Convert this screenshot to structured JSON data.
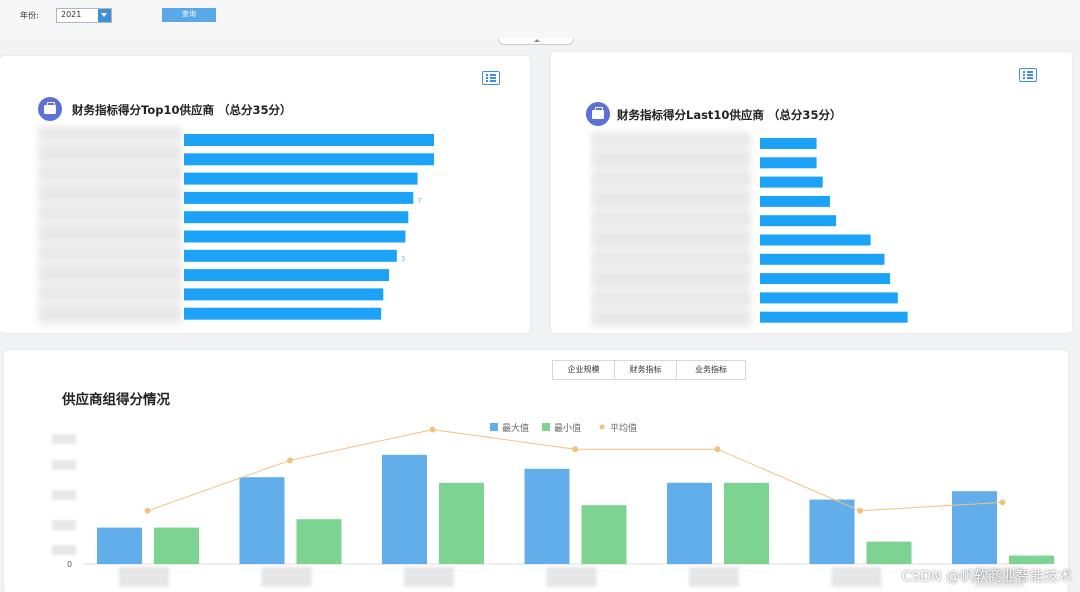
{
  "filter": {
    "year_label": "年份:",
    "year_value": "2021",
    "query_label": "查询"
  },
  "top10": {
    "title": "财务指标得分Top10供应商 （总分35分）",
    "scores": [
      35,
      35,
      32.7,
      32.1,
      31.4,
      31,
      29.8,
      28.7,
      27.9,
      27.6
    ],
    "visible_labels": [
      "7",
      "3"
    ]
  },
  "last10": {
    "title": "财务指标得分Last10供应商 （总分35分）",
    "scores": [
      11,
      11,
      12.2,
      13.6,
      14.8,
      21.5,
      24.2,
      25.3,
      26.8,
      28.7
    ]
  },
  "group_chart": {
    "title": "供应商组得分情况",
    "tabs": [
      "企业规模",
      "财务指标",
      "业务指标"
    ],
    "active_tab": 0,
    "chart_data": {
      "type": "bar",
      "categories": [
        "",
        "",
        "",
        "",
        "",
        "",
        ""
      ],
      "series": [
        {
          "name": "最大值",
          "kind": "bar",
          "color": "#62aeea",
          "values": [
            6.5,
            15.5,
            19.5,
            17.0,
            14.5,
            11.5,
            13.0
          ]
        },
        {
          "name": "最小值",
          "kind": "bar",
          "color": "#7dd391",
          "values": [
            6.5,
            8.0,
            14.5,
            10.5,
            14.5,
            4.0,
            1.5
          ]
        },
        {
          "name": "平均值",
          "kind": "line",
          "color": "#f2c37f",
          "values": [
            9.5,
            18.5,
            24.0,
            20.5,
            20.5,
            9.5,
            11.0
          ]
        }
      ],
      "y_zero_label": "0",
      "ylim": [
        0,
        25
      ]
    }
  },
  "watermark": "CSDN @帆软商业智能技术"
}
